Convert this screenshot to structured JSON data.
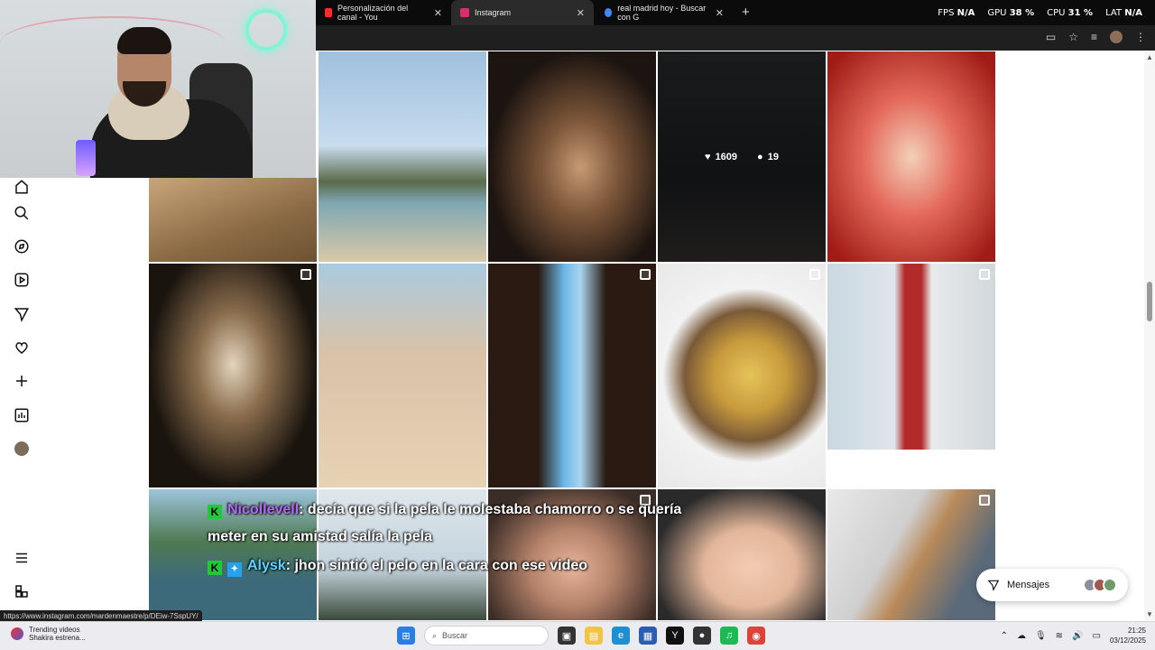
{
  "browser": {
    "tabs": [
      {
        "label": "Personalización del canal - You",
        "color": "#ff2a2a"
      },
      {
        "label": "Instagram",
        "color": "#d6306f"
      },
      {
        "label": "real madrid hoy - Buscar con G",
        "color": "#4285f4"
      }
    ],
    "close_glyph": "✕",
    "new_tab_glyph": "+"
  },
  "overlay_stats": {
    "fps_label": "FPS",
    "fps_value": "N/A",
    "gpu_label": "GPU",
    "gpu_value": "38 %",
    "cpu_label": "CPU",
    "cpu_value": "31 %",
    "lat_label": "LAT",
    "lat_value": "N/A"
  },
  "post_hover": {
    "likes": "1609",
    "comments": "19"
  },
  "chat": {
    "msg1_user": "Nicollevell",
    "msg1_text": ": decía que si la pela le molestaba chamorro o se quería meter en su amistad salía la pela",
    "msg2_user": "Alysk",
    "msg2_text": ": jhon sintió el pelo en la cara con ese video",
    "badge_k": "K",
    "badge_star": "✦"
  },
  "messages": {
    "label": "Mensajes"
  },
  "status_url": "https://www.instagram.com/mardenmaestre/p/DEiw-7SspUY/",
  "taskbar": {
    "news_title": "Trending videos",
    "news_sub": "Shakira estrena...",
    "search_placeholder": "Buscar",
    "time": "21:25",
    "date": "03/12/2025"
  },
  "colors": {
    "accent_instagram": "#d6306f",
    "chat_green": "#20c83a"
  }
}
